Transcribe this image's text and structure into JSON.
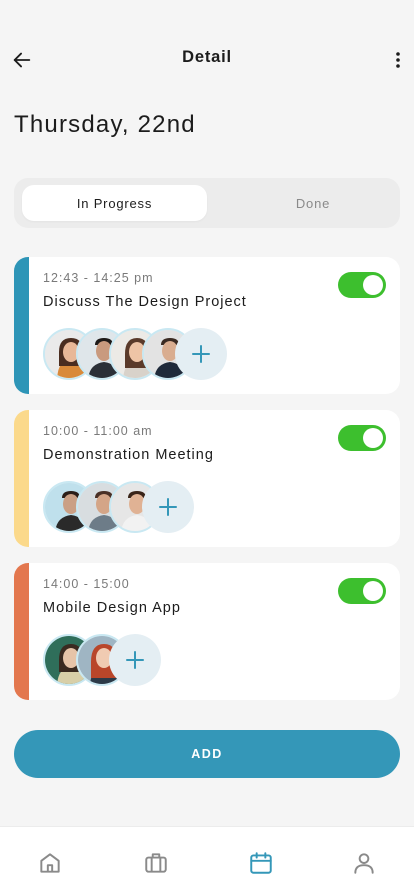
{
  "header": {
    "title": "Detail",
    "back_icon": "arrow-left-icon",
    "more_icon": "more-vertical-icon"
  },
  "date_title": "Thursday, 22nd",
  "tabs": [
    {
      "label": "In Progress",
      "active": true
    },
    {
      "label": "Done",
      "active": false
    }
  ],
  "tasks": [
    {
      "time": "12:43 - 14:25 pm",
      "title": "Discuss The Design Project",
      "accent_color": "#2e95b7",
      "enabled": true,
      "avatars": [
        "woman-avatar",
        "man-avatar",
        "woman-avatar",
        "man-avatar"
      ]
    },
    {
      "time": "10:00 - 11:00 am",
      "title": "Demonstration Meeting",
      "accent_color": "#fbd98b",
      "enabled": true,
      "avatars": [
        "man-avatar",
        "man-avatar",
        "man-avatar"
      ]
    },
    {
      "time": "14:00 - 15:00",
      "title": "Mobile Design App",
      "accent_color": "#e3774e",
      "enabled": true,
      "avatars": [
        "woman-avatar",
        "woman-avatar"
      ]
    }
  ],
  "add_button": {
    "label": "ADD"
  },
  "bottom_nav": [
    {
      "icon": "home-icon",
      "active": false
    },
    {
      "icon": "briefcase-icon",
      "active": false
    },
    {
      "icon": "calendar-icon",
      "active": true
    },
    {
      "icon": "user-icon",
      "active": false
    }
  ],
  "colors": {
    "primary": "#3497b8",
    "toggle_on": "#3dbf2e",
    "background": "#f5f5f5",
    "nav_inactive": "#8a8a8a"
  }
}
